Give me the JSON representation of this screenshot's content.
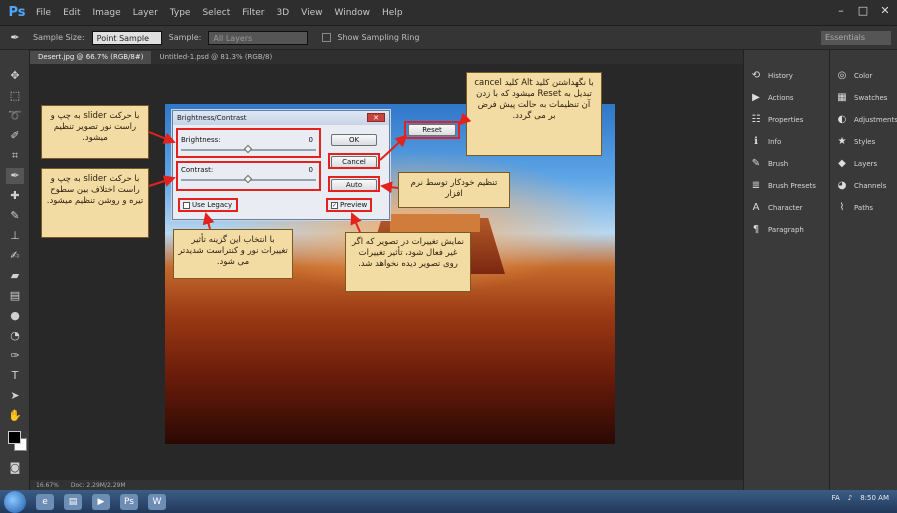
{
  "app": {
    "logo": "Ps",
    "menus": [
      "File",
      "Edit",
      "Image",
      "Layer",
      "Type",
      "Select",
      "Filter",
      "3D",
      "View",
      "Window",
      "Help"
    ],
    "window_controls": [
      "–",
      "□",
      "✕"
    ]
  },
  "options_bar": {
    "sample_size_label": "Sample Size:",
    "sample_size_value": "Point Sample",
    "sample_label": "Sample:",
    "sample_value": "All Layers",
    "show_ring_label": "Show Sampling Ring",
    "workspace": "Essentials"
  },
  "doc_tabs": [
    "Desert.jpg @ 66.7% (RGB/8#)",
    "Untitled-1.psd @ 81.3% (RGB/8)"
  ],
  "status_bar": {
    "zoom": "16.67%",
    "doc": "Doc: 2.29M/2.29M"
  },
  "dialog": {
    "title": "Brightness/Contrast",
    "close": "✕",
    "brightness_label": "Brightness:",
    "brightness_value": "0",
    "contrast_label": "Contrast:",
    "contrast_value": "0",
    "ok_label": "OK",
    "cancel_label": "Cancel",
    "auto_label": "Auto",
    "reset_label": "Reset",
    "use_legacy_label": "Use Legacy",
    "preview_label": "Preview"
  },
  "callouts": {
    "brightness": "با حرکت slider به چپ و راست نور تصویر تنظیم میشود.",
    "contrast": "با حرکت slider به چپ و راست اختلاف بین سطوح تیره و روشن تنظیم میشود.",
    "legacy": "با انتخاب این گزینه تأثیر تغییرات نور و کنتراست شدیدتر می شود.",
    "preview": "نمایش تغییرات در تصویر که اگر غیر فعال شود، تأثیر تغییرات روی تصویر دیده نخواهد شد.",
    "auto": "تنظیم خودکار توسط نرم افزار",
    "reset": "با نگهداشتن کلید Alt کلید cancel تبدیل به Reset میشود که با زدن آن تنظیمات به حالت پیش فرض بر می گردد."
  },
  "panels_left": [
    {
      "icon": "history-icon",
      "glyph": "⟲",
      "label": "History"
    },
    {
      "icon": "actions-icon",
      "glyph": "▶",
      "label": "Actions"
    },
    {
      "icon": "properties-icon",
      "glyph": "☷",
      "label": "Properties"
    },
    {
      "icon": "info-icon",
      "glyph": "ℹ",
      "label": "Info"
    },
    {
      "icon": "brush-icon",
      "glyph": "✎",
      "label": "Brush"
    },
    {
      "icon": "brush-presets-icon",
      "glyph": "≣",
      "label": "Brush Presets"
    },
    {
      "icon": "character-icon",
      "glyph": "A",
      "label": "Character"
    },
    {
      "icon": "paragraph-icon",
      "glyph": "¶",
      "label": "Paragraph"
    }
  ],
  "panels_right": [
    {
      "icon": "color-icon",
      "glyph": "◎",
      "label": "Color"
    },
    {
      "icon": "swatches-icon",
      "glyph": "▦",
      "label": "Swatches"
    },
    {
      "icon": "adjustments-icon",
      "glyph": "◐",
      "label": "Adjustments"
    },
    {
      "icon": "styles-icon",
      "glyph": "★",
      "label": "Styles"
    },
    {
      "icon": "layers-icon",
      "glyph": "◆",
      "label": "Layers"
    },
    {
      "icon": "channels-icon",
      "glyph": "◕",
      "label": "Channels"
    },
    {
      "icon": "paths-icon",
      "glyph": "⌇",
      "label": "Paths"
    }
  ],
  "taskbar": {
    "lang": "FA",
    "time": "8:50 AM"
  }
}
